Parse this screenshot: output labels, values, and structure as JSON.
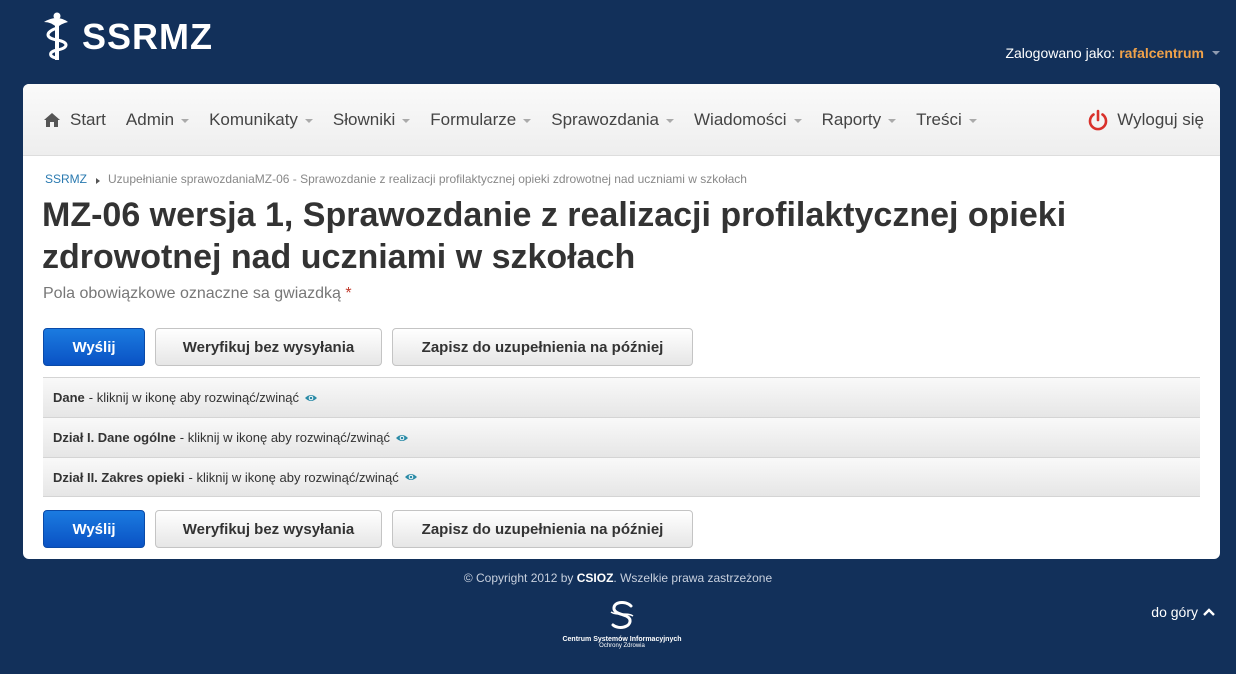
{
  "header": {
    "logo_text": "SSRMZ",
    "logged_in_label": "Zalogowano jako:",
    "username": "rafalcentrum"
  },
  "nav": {
    "items": [
      {
        "label": "Start",
        "icon": "home-icon"
      },
      {
        "label": "Admin"
      },
      {
        "label": "Komunikaty"
      },
      {
        "label": "Słowniki"
      },
      {
        "label": "Formularze"
      },
      {
        "label": "Sprawozdania"
      },
      {
        "label": "Wiadomości"
      },
      {
        "label": "Raporty"
      },
      {
        "label": "Treści"
      }
    ],
    "logout_label": "Wyloguj się",
    "logout_icon": "power-icon"
  },
  "breadcrumb": {
    "root": "SSRMZ",
    "current": "Uzupełnianie sprawozdaniaMZ-06 - Sprawozdanie z realizacji profilaktycznej opieki zdrowotnej nad uczniami w szkołach"
  },
  "page": {
    "title": "MZ-06 wersja 1, Sprawozdanie z realizacji profilaktycznej opieki zdrowotnej nad uczniami w szkołach",
    "required_note": "Pola obowiązkowe oznaczne sa gwiazdką",
    "required_star": "*"
  },
  "actions": {
    "send": "Wyślij",
    "verify": "Weryfikuj bez wysyłania",
    "save": "Zapisz do uzupełnienia na później"
  },
  "sections": [
    {
      "title": "Dane",
      "hint": "- kliknij w ikonę aby rozwinąć/zwinąć"
    },
    {
      "title": "Dział I. Dane ogólne",
      "hint": "- kliknij w ikonę aby rozwinąć/zwinąć"
    },
    {
      "title": "Dział II. Zakres opieki",
      "hint": "- kliknij w ikonę aby rozwinąć/zwinąć"
    }
  ],
  "footer": {
    "copyright_prefix": "© Copyright 2012 by",
    "copyright_brand": "CSIOZ",
    "copyright_suffix": ". Wszelkie prawa zastrzeżone",
    "to_top": "do góry",
    "org_line1": "Centrum Systemów Informacyjnych",
    "org_line2": "Ochrony Zdrowia"
  },
  "colors": {
    "background": "#12305a",
    "accent_username": "#f0a24a",
    "primary_button": "#0a52c4",
    "logout_icon": "#d9312b",
    "eye_icon": "#2a8aa6"
  }
}
